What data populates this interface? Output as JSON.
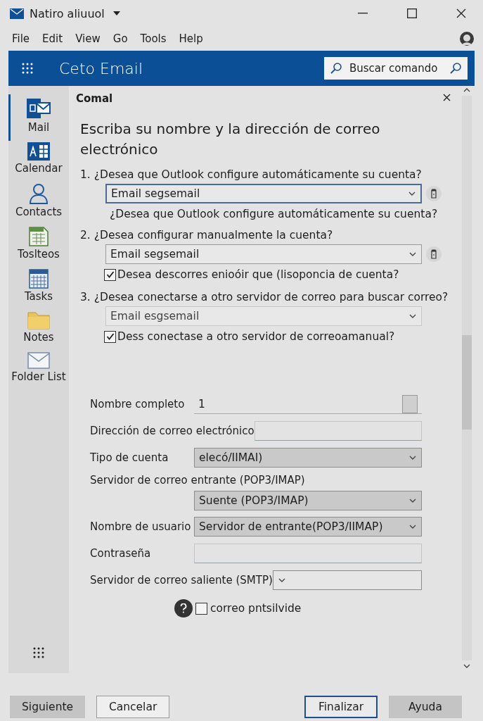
{
  "window": {
    "title": "Natiro aliuuol"
  },
  "menu": [
    "File",
    "Edit",
    "View",
    "Go",
    "Tools",
    "Help"
  ],
  "header": {
    "app_name": "Ceto Email",
    "search": {
      "placeholder": "Buscar comando"
    }
  },
  "sidebar": {
    "items": [
      {
        "label": "Mail",
        "kind": "mail",
        "selected": true
      },
      {
        "label": "Calendar",
        "kind": "calendar",
        "selected": false
      },
      {
        "label": "Contacts",
        "kind": "contacts",
        "selected": false
      },
      {
        "label": "Toslteos",
        "kind": "sheet",
        "selected": false
      },
      {
        "label": "Tasks",
        "kind": "tasks",
        "selected": false
      },
      {
        "label": "Notes",
        "kind": "folder",
        "selected": false
      },
      {
        "label": "Folder List",
        "kind": "envelope",
        "selected": false
      }
    ]
  },
  "panel": {
    "title": "Comal",
    "heading": "Escriba su nombre y la dirección de correo electrónico",
    "questions": [
      {
        "number": "1.",
        "text": "¿Desea que Outlook configure automáticamente su cuenta?",
        "dropdown": {
          "value": "Email segsemail",
          "focused": true,
          "disabled": false
        },
        "side_button": true,
        "extra": {
          "kind": "note",
          "text": "¿Desea que Outlook configure automáticamente su cuenta?"
        }
      },
      {
        "number": "2.",
        "text": "¿Desea configurar manualmente la cuenta?",
        "dropdown": {
          "value": "Email segsemail",
          "focused": false,
          "disabled": false
        },
        "side_button": true,
        "extra": {
          "kind": "checkbox",
          "text": "Desea descorres enioóir que (lisoponcia de cuenta?",
          "checked": true
        }
      },
      {
        "number": "3.",
        "text": "¿Desea conectarse a otro servidor de correo para buscar correo?",
        "dropdown": {
          "value": "Email esgsemail",
          "focused": false,
          "disabled": true
        },
        "side_button": false,
        "extra": {
          "kind": "checkbox",
          "text": "Dess conectase a otro servidor de correoamanual?",
          "checked": true
        }
      }
    ],
    "form": [
      {
        "label": "Nombre completo",
        "kind": "text",
        "value": "1",
        "side_button": true
      },
      {
        "label": "Dirección de correo electrónico",
        "kind": "text"
      },
      {
        "label": "Tipo de cuenta",
        "kind": "select",
        "value": "elecó/IIMAI)",
        "shaded": true
      },
      {
        "label": "Servidor de correo entrante (POP3/IMAP)",
        "kind": "select",
        "value": "Suente (POP3/IMAP)",
        "shaded": true,
        "stacked": true
      },
      {
        "label": "Nombre de usuario",
        "kind": "select",
        "value": "Servidor de entrante(POP3/IIMAP)",
        "shaded": true
      },
      {
        "label": "Contraseña",
        "kind": "text"
      },
      {
        "label": "Servidor de correo saliente (SMTP)",
        "kind": "select",
        "shaded": false
      }
    ],
    "bottom_checkbox": {
      "text": "correo pntsilvide",
      "checked": false
    }
  },
  "buttons": [
    {
      "label": "Siguiente",
      "kind": "filled"
    },
    {
      "label": "Cancelar",
      "kind": "outline"
    },
    {
      "label": "Finalizar",
      "kind": "default"
    },
    {
      "label": "Ayuda",
      "kind": "filled"
    }
  ]
}
